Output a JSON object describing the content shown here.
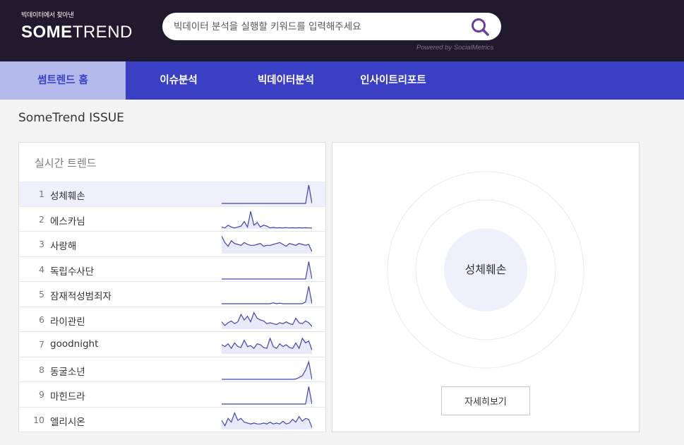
{
  "header": {
    "tagline": "빅데이터에서 찾아낸",
    "brand_bold": "SOME",
    "brand_light": "TREND",
    "search_placeholder": "빅데이터 분석을 실행할 키워드를 입력해주세요",
    "search_icon": "search-icon",
    "powered_by": "Powered by SocialMetrics"
  },
  "nav": {
    "tabs": [
      {
        "label": "썸트렌드 홈",
        "active": true
      },
      {
        "label": "이슈분석",
        "active": false
      },
      {
        "label": "빅데이터분석",
        "active": false
      },
      {
        "label": "인사이트리포트",
        "active": false
      }
    ]
  },
  "section": {
    "title": "SomeTrend ISSUE"
  },
  "realtime": {
    "heading": "실시간 트렌드",
    "items": [
      {
        "rank": "1",
        "keyword": "성체훼손",
        "trend": [
          0,
          0,
          0,
          0,
          0,
          0,
          0,
          0,
          0,
          0,
          0,
          0,
          0,
          0,
          0,
          0,
          0,
          0,
          0,
          0,
          0,
          0,
          0,
          0,
          0,
          0,
          0,
          1,
          0
        ]
      },
      {
        "rank": "2",
        "keyword": "에스카님",
        "trend": [
          0.1,
          0.05,
          0.2,
          0.1,
          0.05,
          0.1,
          0.15,
          0.4,
          0.1,
          0.95,
          0.2,
          0.35,
          0.1,
          0.2,
          0.15,
          0.05,
          0.08,
          0.05,
          0.06,
          0.05,
          0.07,
          0.05,
          0.06,
          0.05,
          0.06,
          0.05,
          0.06,
          0.05,
          0.05
        ]
      },
      {
        "rank": "3",
        "keyword": "사랑해",
        "trend": [
          0.95,
          0.6,
          0.4,
          0.7,
          0.55,
          0.5,
          0.45,
          0.6,
          0.5,
          0.45,
          0.45,
          0.5,
          0.55,
          0.4,
          0.45,
          0.45,
          0.5,
          0.55,
          0.6,
          0.5,
          0.4,
          0.55,
          0.5,
          0.45,
          0.55,
          0.5,
          0.45,
          0.5,
          0.1
        ]
      },
      {
        "rank": "4",
        "keyword": "독립수사단",
        "trend": [
          0,
          0,
          0,
          0,
          0,
          0,
          0,
          0,
          0,
          0,
          0,
          0,
          0,
          0,
          0,
          0,
          0,
          0,
          0,
          0,
          0,
          0,
          0,
          0,
          0,
          0,
          0,
          0.95,
          0
        ]
      },
      {
        "rank": "5",
        "keyword": "잠재적성범죄자",
        "trend": [
          0,
          0,
          0,
          0,
          0,
          0,
          0,
          0,
          0,
          0,
          0,
          0,
          0,
          0,
          0,
          0,
          0.05,
          0,
          0.03,
          0,
          0,
          0,
          0,
          0,
          0,
          0,
          0.1,
          0.95,
          0
        ]
      },
      {
        "rank": "6",
        "keyword": "라이관린",
        "trend": [
          0.4,
          0.2,
          0.35,
          0.45,
          0.3,
          0.4,
          0.8,
          0.5,
          0.7,
          0.4,
          0.9,
          0.6,
          0.5,
          0.45,
          0.3,
          0.35,
          0.3,
          0.25,
          0.35,
          0.3,
          0.4,
          0.3,
          0.25,
          0.6,
          0.35,
          0.3,
          0.45,
          0.35,
          0.15
        ]
      },
      {
        "rank": "7",
        "keyword": "goodnight",
        "trend": [
          0.5,
          0.4,
          0.55,
          0.3,
          0.6,
          0.4,
          0.35,
          0.75,
          0.4,
          0.45,
          0.3,
          0.55,
          0.5,
          0.35,
          0.3,
          0.85,
          0.4,
          0.3,
          0.55,
          0.4,
          0.5,
          0.35,
          0.3,
          0.6,
          0.3,
          0.85,
          0.6,
          0.7,
          0.2
        ]
      },
      {
        "rank": "8",
        "keyword": "동굴소년",
        "trend": [
          0,
          0,
          0,
          0,
          0,
          0,
          0,
          0,
          0,
          0,
          0,
          0,
          0,
          0,
          0,
          0,
          0,
          0,
          0,
          0,
          0,
          0,
          0,
          0.02,
          0.1,
          0.2,
          0.5,
          0.95,
          0
        ]
      },
      {
        "rank": "9",
        "keyword": "마힌드라",
        "trend": [
          0,
          0,
          0,
          0,
          0,
          0,
          0,
          0,
          0,
          0,
          0,
          0,
          0,
          0,
          0,
          0,
          0,
          0,
          0,
          0,
          0,
          0,
          0,
          0,
          0,
          0,
          0,
          0.95,
          0
        ]
      },
      {
        "rank": "10",
        "keyword": "엘리시온",
        "trend": [
          0.5,
          0.2,
          0.6,
          0.4,
          0.9,
          0.5,
          0.6,
          0.4,
          0.35,
          0.3,
          0.35,
          0.3,
          0.3,
          0.35,
          0.3,
          0.4,
          0.3,
          0.35,
          0.3,
          0.45,
          0.3,
          0.35,
          0.55,
          0.4,
          0.7,
          0.45,
          0.6,
          0.55,
          0.1
        ]
      }
    ]
  },
  "issue_panel": {
    "center_keyword": "성체훼손",
    "more_button": "자세히보기"
  },
  "colors": {
    "header_bg": "#1f1a2d",
    "nav_bg": "#3a3fc4",
    "nav_active_bg": "#b3baeb",
    "sparkline_stroke": "#4044b0",
    "sparkline_fill": "#e8eaf9",
    "bubble_fill": "#eef0fc"
  }
}
